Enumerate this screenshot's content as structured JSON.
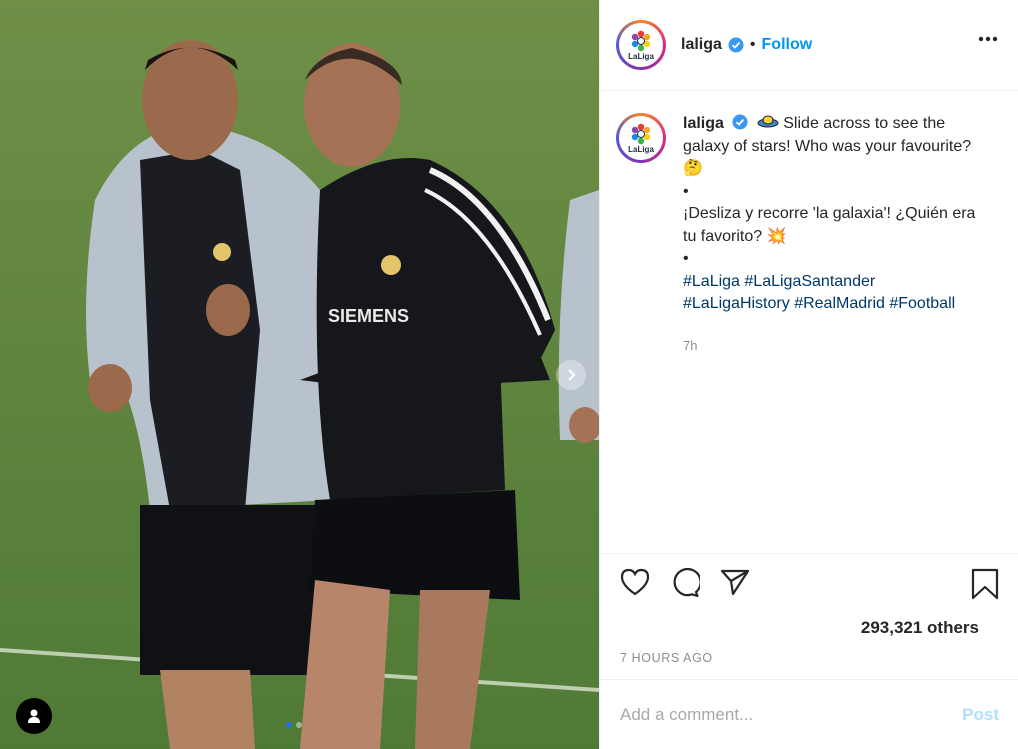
{
  "post": {
    "username": "laliga",
    "separator": "•",
    "follow_label": "Follow",
    "avatar_logo_text": "LaLiga",
    "caption": {
      "username": "laliga",
      "line_en_1": " Slide across to see the galaxy of stars! Who was your favourite? 🤔",
      "bullet_1": "•",
      "line_es": "¡Desliza y recorre 'la galaxia'! ¿Quién era tu favorito? 💥",
      "bullet_2": "•",
      "hashtags": [
        "#LaLiga",
        "#LaLigaSantander",
        "#LaLigaHistory",
        "#RealMadrid",
        "#Football"
      ],
      "relative_time": "7h"
    },
    "likes_text": "293,321 others",
    "posted_time": "7 HOURS AGO"
  },
  "comment": {
    "placeholder": "Add a comment...",
    "post_label": "Post"
  },
  "media": {
    "jersey_sponsor": "SIEMENS",
    "carousel_dots": 2,
    "active_dot": 0
  },
  "colors": {
    "follow": "#0095f6",
    "hashtag": "#00376b",
    "post_disabled": "#b2dffc",
    "verified": "#3897f0"
  },
  "icons": {
    "user_tag": "person-icon",
    "carousel_next": "chevron-right-icon",
    "more": "more-horizontal-icon",
    "like": "heart-icon",
    "comment": "comment-icon",
    "share": "paper-plane-icon",
    "save": "bookmark-icon",
    "verified": "verified-badge-icon"
  }
}
